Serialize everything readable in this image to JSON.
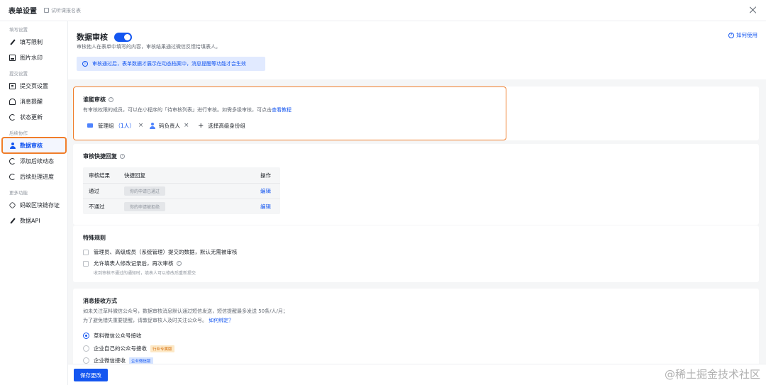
{
  "topbar": {
    "title": "表单设置",
    "hint": "试听课报名表"
  },
  "sidebar": {
    "groups": [
      {
        "label": "填写设置",
        "items": [
          "填写限制",
          "图片水印"
        ]
      },
      {
        "label": "提交设置",
        "items": [
          "提交页设置",
          "消息提醒",
          "状态更新"
        ]
      },
      {
        "label": "后续协作",
        "items": [
          "数据审核",
          "添加后续动态",
          "后续处理进度"
        ]
      },
      {
        "label": "更多功能",
        "items": [
          "蚂蚁区块链存证",
          "数据API"
        ]
      }
    ],
    "active": "数据审核"
  },
  "header": {
    "title": "数据审核",
    "toggle_on": true,
    "desc": "审核他人在表单中填写的内容，审核结果通过微信反馈给填表人。",
    "notice": "审核通过后，表单数据才展示在动态档案中，消息提醒等功能才会生效",
    "howto": "如何使用"
  },
  "reviewers": {
    "title": "谁能审核",
    "desc": "有审核权限的成员，可以在小程序的「待审核列表」进行审核。如需多级审核，可点击",
    "desc_link": "查看教程",
    "chips": [
      {
        "label": "管理组",
        "count": "（1人）"
      },
      {
        "label": "码负责人"
      }
    ],
    "add_label": "选择高级身份组"
  },
  "quick_reply": {
    "title": "审核快捷回复",
    "headers": [
      "审核结果",
      "快捷回复",
      "操作"
    ],
    "rows": [
      {
        "result": "通过",
        "reply": "你的申请已通过",
        "action": "编辑"
      },
      {
        "result": "不通过",
        "reply": "你的申请被拒绝",
        "action": "编辑"
      }
    ]
  },
  "special_rules": {
    "title": "特殊规则",
    "options": [
      {
        "label": "管理员、高级成员（系统管理）提交的数据，默认无需被审核",
        "checked": false
      },
      {
        "label": "允许填表人修改记录后，再次审核",
        "checked": false,
        "sub": "收到审核不通过的通知时，填表人可以修改后重新提交"
      }
    ]
  },
  "receive": {
    "title": "消息接收方式",
    "desc1": "如未关注草料微信公众号，数据审核消息默认通过短信发送，短信提醒最多发送 50条/人/月；",
    "desc2": "为了避免错失重要提醒，请敦促审核人及时关注公众号。",
    "desc2_link": "如何绑定？",
    "options": [
      {
        "label": "草料微信公众号接收",
        "selected": true
      },
      {
        "label": "企业自己的公众号接收",
        "tag": "行业专属版",
        "tag_color": "orange"
      },
      {
        "label": "企业微信接收",
        "tag": "企业微信版",
        "tag_color": "blue"
      }
    ]
  },
  "footer": {
    "save_label": "保存更改"
  },
  "watermark": "@稀土掘金技术社区",
  "colors": {
    "accent": "#1456f0",
    "highlight": "#f07d2a",
    "notice_bg": "#e1eaff"
  }
}
